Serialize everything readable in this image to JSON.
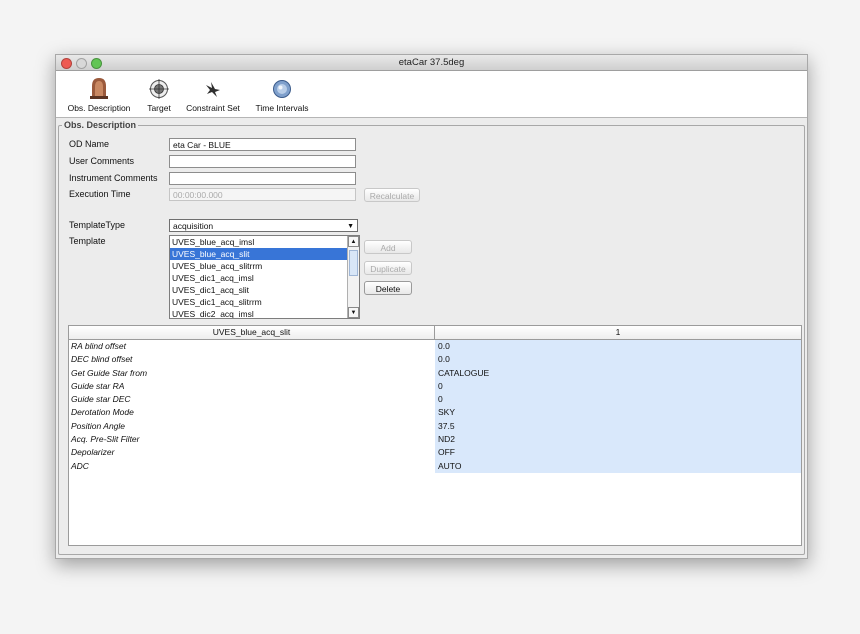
{
  "window": {
    "title": "etaCar 37.5deg"
  },
  "toolbar": {
    "items": [
      {
        "label": "Obs. Description",
        "icon": "observer-icon"
      },
      {
        "label": "Target",
        "icon": "target-globe-icon"
      },
      {
        "label": "Constraint Set",
        "icon": "constraint-icon"
      },
      {
        "label": "Time Intervals",
        "icon": "time-intervals-icon"
      }
    ]
  },
  "panel": {
    "title": "Obs. Description",
    "od_name_label": "OD Name",
    "od_name_value": "eta Car - BLUE",
    "user_comments_label": "User Comments",
    "user_comments_value": "",
    "instrument_comments_label": "Instrument Comments",
    "instrument_comments_value": "",
    "execution_time_label": "Execution Time",
    "execution_time_value": "00:00:00.000",
    "recalculate_label": "Recalculate",
    "template_type_label": "TemplateType",
    "template_type_value": "acquisition",
    "template_label": "Template",
    "templates": [
      "UVES_blue_acq_imsl",
      "UVES_blue_acq_slit",
      "UVES_blue_acq_slitrrm",
      "UVES_dic1_acq_imsl",
      "UVES_dic1_acq_slit",
      "UVES_dic1_acq_slitrrm",
      "UVES_dic2_acq_imsl"
    ],
    "selected_template": "UVES_blue_acq_slit",
    "add_label": "Add",
    "duplicate_label": "Duplicate",
    "delete_label": "Delete"
  },
  "table": {
    "header": [
      "UVES_blue_acq_slit",
      "1"
    ],
    "rows": [
      {
        "param": "RA blind offset",
        "value": "0.0"
      },
      {
        "param": "DEC blind offset",
        "value": "0.0"
      },
      {
        "param": "Get Guide Star from",
        "value": "CATALOGUE"
      },
      {
        "param": "Guide star RA",
        "value": "0"
      },
      {
        "param": "Guide star DEC",
        "value": "0"
      },
      {
        "param": "Derotation Mode",
        "value": "SKY"
      },
      {
        "param": "Position Angle",
        "value": "37.5"
      },
      {
        "param": "Acq. Pre-Slit Filter",
        "value": "ND2"
      },
      {
        "param": "Depolarizer",
        "value": "OFF"
      },
      {
        "param": "ADC",
        "value": "AUTO"
      }
    ]
  }
}
